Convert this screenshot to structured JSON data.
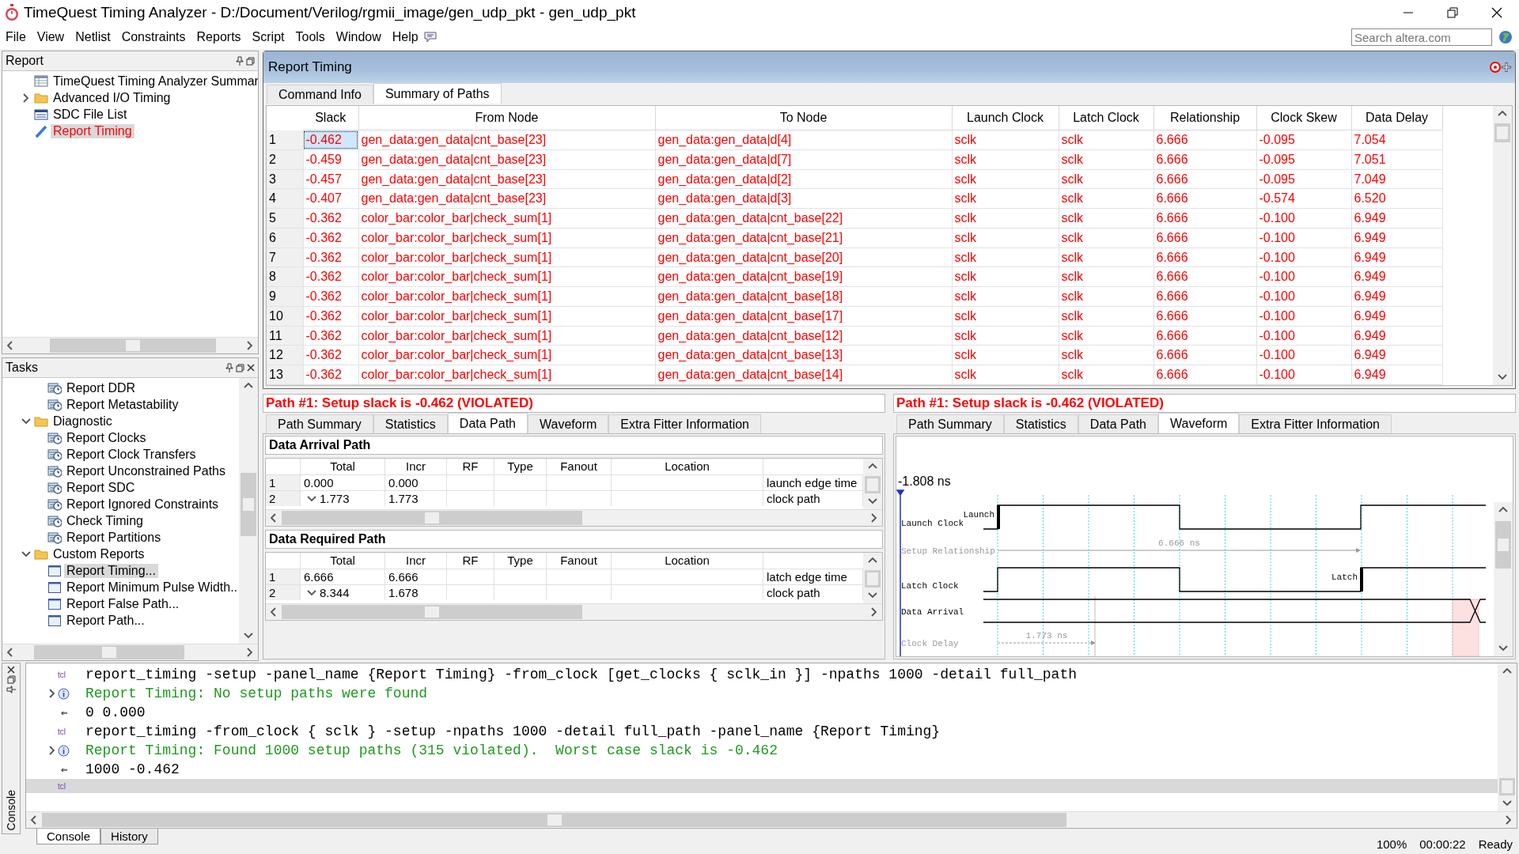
{
  "window": {
    "title": "TimeQuest Timing Analyzer - D:/Document/Verilog/rgmii_image/gen_udp_pkt - gen_udp_pkt"
  },
  "menu": [
    "File",
    "View",
    "Netlist",
    "Constraints",
    "Reports",
    "Script",
    "Tools",
    "Window",
    "Help"
  ],
  "search": {
    "placeholder": "Search altera.com"
  },
  "report_panel": {
    "title": "Report",
    "items": [
      {
        "label": "TimeQuest Timing Analyzer Summar",
        "kind": "table",
        "collapsed": false,
        "selected": false
      },
      {
        "label": "Advanced I/O Timing",
        "kind": "folder",
        "collapsed": true,
        "selected": false
      },
      {
        "label": "SDC File List",
        "kind": "list",
        "collapsed": false,
        "selected": false
      },
      {
        "label": "Report Timing",
        "kind": "report",
        "collapsed": false,
        "selected": true
      }
    ]
  },
  "tasks_panel": {
    "title": "Tasks",
    "items": [
      {
        "label": "Report DDR",
        "kind": "task",
        "selected": false
      },
      {
        "label": "Report Metastability",
        "kind": "task",
        "selected": false
      },
      {
        "label": "Diagnostic",
        "kind": "folder",
        "selected": false,
        "expanded": true,
        "children": [
          {
            "label": "Report Clocks",
            "kind": "task",
            "selected": false
          },
          {
            "label": "Report Clock Transfers",
            "kind": "task",
            "selected": false
          },
          {
            "label": "Report Unconstrained Paths",
            "kind": "task",
            "selected": false
          },
          {
            "label": "Report SDC",
            "kind": "task",
            "selected": false
          },
          {
            "label": "Report Ignored Constraints",
            "kind": "task",
            "selected": false
          },
          {
            "label": "Check Timing",
            "kind": "task",
            "selected": false
          },
          {
            "label": "Report Partitions",
            "kind": "task",
            "selected": false
          }
        ]
      },
      {
        "label": "Custom Reports",
        "kind": "folder",
        "selected": false,
        "expanded": true,
        "children": [
          {
            "label": "Report Timing...",
            "kind": "custom",
            "selected": true
          },
          {
            "label": "Report Minimum Pulse Width..",
            "kind": "custom",
            "selected": false
          },
          {
            "label": "Report False Path...",
            "kind": "custom",
            "selected": false
          },
          {
            "label": "Report Path...",
            "kind": "custom",
            "selected": false
          }
        ]
      }
    ]
  },
  "report_timing": {
    "title": "Report Timing",
    "tabs": [
      {
        "label": "Command Info",
        "selected": false
      },
      {
        "label": "Summary of Paths",
        "selected": true
      }
    ],
    "table": {
      "columns": [
        "Slack",
        "From Node",
        "To Node",
        "Launch Clock",
        "Latch Clock",
        "Relationship",
        "Clock Skew",
        "Data Delay"
      ],
      "rows": [
        {
          "number": "1",
          "selected": true,
          "cells": [
            "-0.462",
            "gen_data:gen_data|cnt_base[23]",
            "gen_data:gen_data|d[4]",
            "sclk",
            "sclk",
            "6.666",
            "-0.095",
            "7.054"
          ]
        },
        {
          "number": "2",
          "selected": false,
          "cells": [
            "-0.459",
            "gen_data:gen_data|cnt_base[23]",
            "gen_data:gen_data|d[7]",
            "sclk",
            "sclk",
            "6.666",
            "-0.095",
            "7.051"
          ]
        },
        {
          "number": "3",
          "selected": false,
          "cells": [
            "-0.457",
            "gen_data:gen_data|cnt_base[23]",
            "gen_data:gen_data|d[2]",
            "sclk",
            "sclk",
            "6.666",
            "-0.095",
            "7.049"
          ]
        },
        {
          "number": "4",
          "selected": false,
          "cells": [
            "-0.407",
            "gen_data:gen_data|cnt_base[23]",
            "gen_data:gen_data|d[3]",
            "sclk",
            "sclk",
            "6.666",
            "-0.574",
            "6.520"
          ]
        },
        {
          "number": "5",
          "selected": false,
          "cells": [
            "-0.362",
            "color_bar:color_bar|check_sum[1]",
            "gen_data:gen_data|cnt_base[22]",
            "sclk",
            "sclk",
            "6.666",
            "-0.100",
            "6.949"
          ]
        },
        {
          "number": "6",
          "selected": false,
          "cells": [
            "-0.362",
            "color_bar:color_bar|check_sum[1]",
            "gen_data:gen_data|cnt_base[21]",
            "sclk",
            "sclk",
            "6.666",
            "-0.100",
            "6.949"
          ]
        },
        {
          "number": "7",
          "selected": false,
          "cells": [
            "-0.362",
            "color_bar:color_bar|check_sum[1]",
            "gen_data:gen_data|cnt_base[20]",
            "sclk",
            "sclk",
            "6.666",
            "-0.100",
            "6.949"
          ]
        },
        {
          "number": "8",
          "selected": false,
          "cells": [
            "-0.362",
            "color_bar:color_bar|check_sum[1]",
            "gen_data:gen_data|cnt_base[19]",
            "sclk",
            "sclk",
            "6.666",
            "-0.100",
            "6.949"
          ]
        },
        {
          "number": "9",
          "selected": false,
          "cells": [
            "-0.362",
            "color_bar:color_bar|check_sum[1]",
            "gen_data:gen_data|cnt_base[18]",
            "sclk",
            "sclk",
            "6.666",
            "-0.100",
            "6.949"
          ]
        },
        {
          "number": "10",
          "selected": false,
          "cells": [
            "-0.362",
            "color_bar:color_bar|check_sum[1]",
            "gen_data:gen_data|cnt_base[17]",
            "sclk",
            "sclk",
            "6.666",
            "-0.100",
            "6.949"
          ]
        },
        {
          "number": "11",
          "selected": false,
          "cells": [
            "-0.362",
            "color_bar:color_bar|check_sum[1]",
            "gen_data:gen_data|cnt_base[12]",
            "sclk",
            "sclk",
            "6.666",
            "-0.100",
            "6.949"
          ]
        },
        {
          "number": "12",
          "selected": false,
          "cells": [
            "-0.362",
            "color_bar:color_bar|check_sum[1]",
            "gen_data:gen_data|cnt_base[13]",
            "sclk",
            "sclk",
            "6.666",
            "-0.100",
            "6.949"
          ]
        },
        {
          "number": "13",
          "selected": false,
          "cells": [
            "-0.362",
            "color_bar:color_bar|check_sum[1]",
            "gen_data:gen_data|cnt_base[14]",
            "sclk",
            "sclk",
            "6.666",
            "-0.100",
            "6.949"
          ]
        }
      ]
    }
  },
  "path_panels": [
    {
      "kind": "data_path",
      "title": "Path #1: Setup slack is -0.462 (VIOLATED)",
      "tabs": [
        {
          "label": "Path Summary",
          "selected": false
        },
        {
          "label": "Statistics",
          "selected": false
        },
        {
          "label": "Data Path",
          "selected": true
        },
        {
          "label": "Waveform",
          "selected": false
        },
        {
          "label": "Extra Fitter Information",
          "selected": false
        }
      ],
      "sections": [
        {
          "title": "Data Arrival Path",
          "columns": [
            "Total",
            "Incr",
            "RF",
            "Type",
            "Fanout",
            "Location"
          ],
          "rows": [
            {
              "number": "1",
              "total": "0.000",
              "incr": "0.000",
              "column_8": "launch edge time",
              "expandable": false
            },
            {
              "number": "2",
              "total": "1.773",
              "incr": "1.773",
              "column_8": "clock path",
              "expandable": true
            }
          ]
        },
        {
          "title": "Data Required Path",
          "columns": [
            "Total",
            "Incr",
            "RF",
            "Type",
            "Fanout",
            "Location"
          ],
          "rows": [
            {
              "number": "1",
              "total": "6.666",
              "incr": "6.666",
              "column_8": "latch edge time",
              "expandable": false
            },
            {
              "number": "2",
              "total": "8.344",
              "incr": "1.678",
              "column_8": "clock path",
              "expandable": true
            }
          ]
        }
      ]
    },
    {
      "kind": "waveform",
      "title": "Path #1: Setup slack is -0.462 (VIOLATED)",
      "tabs": [
        {
          "label": "Path Summary",
          "selected": false
        },
        {
          "label": "Statistics",
          "selected": false
        },
        {
          "label": "Data Path",
          "selected": false
        },
        {
          "label": "Waveform",
          "selected": true
        },
        {
          "label": "Extra Fitter Information",
          "selected": false
        }
      ],
      "waveform": {
        "time_marker": "-1.808 ns",
        "signals": [
          {
            "kind": "clock",
            "name": "Launch Clock",
            "edge_label": "Launch"
          },
          {
            "kind": "span",
            "name": "Setup Relationship",
            "value": "6.666 ns"
          },
          {
            "kind": "clock",
            "name": "Latch Clock",
            "edge_label": "Latch"
          },
          {
            "kind": "data",
            "name": "Data Arrival"
          },
          {
            "kind": "span",
            "name": "Clock Delay",
            "value": "1.773 ns"
          }
        ]
      }
    }
  ],
  "console": {
    "side_label": "Console",
    "lines": [
      {
        "kind": "command",
        "prompt": "tcl",
        "text": "report_timing -setup -panel_name {Report Timing} -from_clock [get_clocks { sclk_in }] -npaths 1000 -detail full_path"
      },
      {
        "kind": "info",
        "text": "Report Timing: No setup paths were found"
      },
      {
        "kind": "result",
        "arrow": "⇐",
        "text": "0 0.000"
      },
      {
        "kind": "command",
        "prompt": "tcl",
        "text": "report_timing -from_clock { sclk } -setup -npaths 1000 -detail full_path -panel_name {Report Timing}"
      },
      {
        "kind": "info",
        "text": "Report Timing: Found 1000 setup paths (315 violated).  Worst case slack is -0.462"
      },
      {
        "kind": "result",
        "arrow": "⇐",
        "text": "1000 -0.462"
      },
      {
        "kind": "input",
        "prompt": "tcl"
      }
    ],
    "tabs": [
      {
        "label": "Console",
        "selected": true
      },
      {
        "label": "History",
        "selected": false
      }
    ]
  },
  "status_bar": {
    "zoom": "100%",
    "time": "00:00:22",
    "state": "Ready"
  }
}
